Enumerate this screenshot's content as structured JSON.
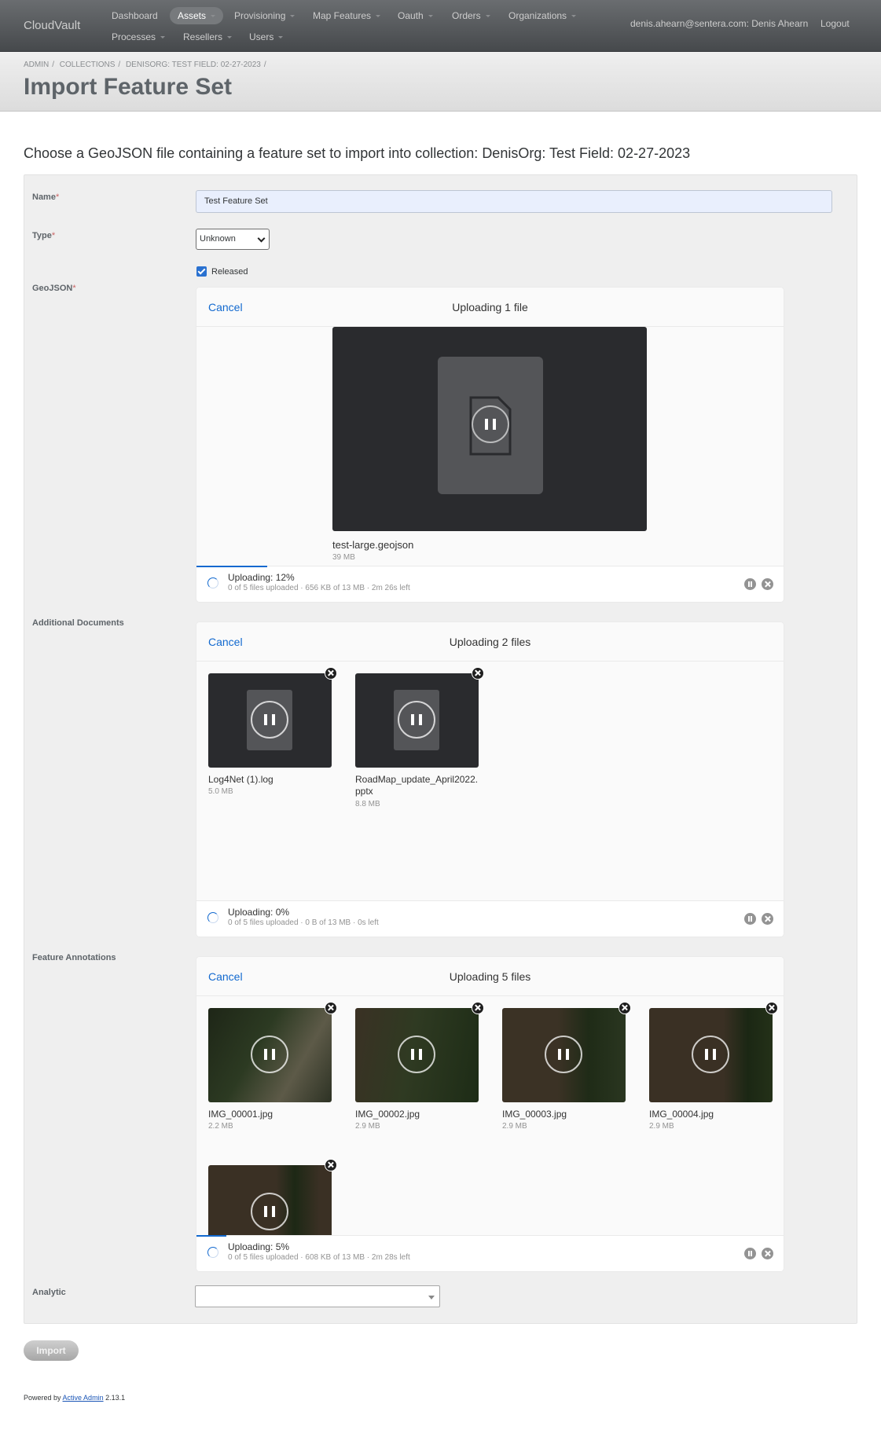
{
  "app": {
    "brand": "CloudVault"
  },
  "nav": {
    "row1": [
      "Dashboard",
      "Assets",
      "Provisioning",
      "Map Features",
      "Oauth",
      "Orders",
      "Organizations"
    ],
    "row2": [
      "Processes",
      "Resellers",
      "Users"
    ],
    "current": "Assets",
    "user": "denis.ahearn@sentera.com: Denis Ahearn",
    "logout": "Logout"
  },
  "breadcrumb": [
    "ADMIN",
    "COLLECTIONS",
    "DENISORG: TEST FIELD: 02-27-2023"
  ],
  "page_title": "Import Feature Set",
  "intro": "Choose a GeoJSON file containing a feature set to import into collection: DenisOrg: Test Field: 02-27-2023",
  "form": {
    "name_label": "Name",
    "name_value": "Test Feature Set",
    "type_label": "Type",
    "type_value": "Unknown",
    "released_label": "Released",
    "released_checked": true,
    "geojson_label": "GeoJSON",
    "additional_label": "Additional Documents",
    "annotations_label": "Feature Annotations",
    "analytic_label": "Analytic",
    "required_mark": "*"
  },
  "geojson_upload": {
    "cancel": "Cancel",
    "title": "Uploading 1 file",
    "file_name": "test-large.geojson",
    "file_size": "39 MB",
    "status": "Uploading: 12%",
    "progress": 0.12,
    "detail": "0 of 5 files uploaded · 656 KB of 13 MB · 2m 26s left"
  },
  "docs_upload": {
    "cancel": "Cancel",
    "title": "Uploading 2 files",
    "files": [
      {
        "name": "Log4Net (1).log",
        "size": "5.0 MB"
      },
      {
        "name": "RoadMap_update_April2022.pptx",
        "size": "8.8 MB"
      }
    ],
    "status": "Uploading: 0%",
    "progress": 0,
    "detail": "0 of 5 files uploaded · 0 B of 13 MB · 0s left"
  },
  "annotations_upload": {
    "cancel": "Cancel",
    "title": "Uploading 5 files",
    "files": [
      {
        "name": "IMG_00001.jpg",
        "size": "2.2 MB"
      },
      {
        "name": "IMG_00002.jpg",
        "size": "2.9 MB"
      },
      {
        "name": "IMG_00003.jpg",
        "size": "2.9 MB"
      },
      {
        "name": "IMG_00004.jpg",
        "size": "2.9 MB"
      }
    ],
    "status": "Uploading: 5%",
    "progress": 0.05,
    "detail": "0 of 5 files uploaded · 608 KB of 13 MB · 2m 28s left"
  },
  "actions": {
    "import": "Import"
  },
  "footer": {
    "prefix": "Powered by",
    "link": "Active Admin",
    "version": "2.13.1"
  },
  "colors": {
    "accent": "#1269cf",
    "header": "#46494c",
    "title": "#5e6469"
  }
}
